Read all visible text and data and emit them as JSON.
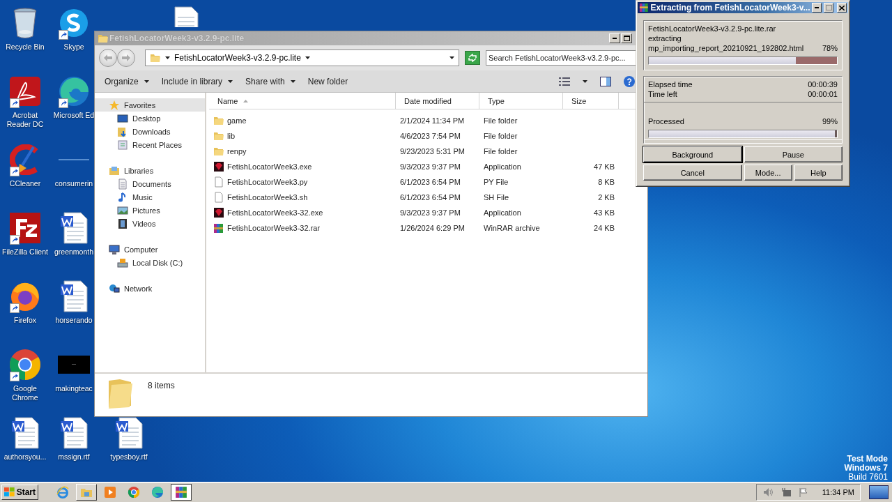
{
  "desktop": {
    "columns": [
      [
        {
          "label": "Recycle Bin",
          "kind": "recycle",
          "shortcut": false
        },
        {
          "label": "Acrobat Reader DC",
          "kind": "acrobat",
          "shortcut": true
        },
        {
          "label": "CCleaner",
          "kind": "ccleaner",
          "shortcut": true
        },
        {
          "label": "FileZilla Client",
          "kind": "filezilla",
          "shortcut": true
        },
        {
          "label": "Firefox",
          "kind": "firefox",
          "shortcut": true
        },
        {
          "label": "Google Chrome",
          "kind": "chrome",
          "shortcut": true
        },
        {
          "label": "authorsyou...",
          "kind": "word",
          "shortcut": false
        }
      ],
      [
        {
          "label": "Skype",
          "kind": "skype",
          "shortcut": true
        },
        {
          "label": "Microsoft Ed",
          "kind": "edge",
          "shortcut": true
        },
        {
          "label": "consumerin",
          "kind": "blank",
          "shortcut": false
        },
        {
          "label": "greenmonth",
          "kind": "word",
          "shortcut": false
        },
        {
          "label": "horserando",
          "kind": "word",
          "shortcut": false
        },
        {
          "label": "makingteac",
          "kind": "black",
          "shortcut": false
        },
        {
          "label": "mssign.rtf",
          "kind": "word",
          "shortcut": false
        }
      ],
      [
        null,
        null,
        null,
        null,
        null,
        null,
        {
          "label": "typesboy.rtf",
          "kind": "word",
          "shortcut": false
        }
      ],
      [
        {
          "kind": "document",
          "shortcut": false
        }
      ]
    ],
    "notice": [
      "Test Mode",
      "Windows 7",
      "Build 7601"
    ]
  },
  "explorer": {
    "title": "FetishLocatorWeek3-v3.2.9-pc.lite",
    "address": "FetishLocatorWeek3-v3.2.9-pc.lite",
    "search": {
      "placeholder": "Search FetishLocatorWeek3-v3.2.9-pc..."
    },
    "toolbar": [
      {
        "label": "Organize",
        "dropdown": true
      },
      {
        "label": "Include in library",
        "dropdown": true
      },
      {
        "label": "Share with",
        "dropdown": true
      },
      {
        "label": "New folder",
        "dropdown": false
      }
    ],
    "nav": [
      {
        "label": "Favorites",
        "kind": "star",
        "selected": true,
        "children": [
          {
            "label": "Desktop",
            "kind": "desktop",
            "selected": false
          },
          {
            "label": "Downloads",
            "kind": "downloads",
            "selected": false
          },
          {
            "label": "Recent Places",
            "kind": "recent",
            "selected": false
          }
        ]
      },
      {
        "label": "Libraries",
        "kind": "library",
        "selected": false,
        "children": [
          {
            "label": "Documents",
            "kind": "documents",
            "selected": false
          },
          {
            "label": "Music",
            "kind": "music",
            "selected": false
          },
          {
            "label": "Pictures",
            "kind": "pictures",
            "selected": false
          },
          {
            "label": "Videos",
            "kind": "videos",
            "selected": false
          }
        ]
      },
      {
        "label": "Computer",
        "kind": "computer",
        "selected": false,
        "children": [
          {
            "label": "Local Disk (C:)",
            "kind": "disk",
            "selected": false
          }
        ]
      },
      {
        "label": "Network",
        "kind": "network",
        "selected": false
      }
    ],
    "columns": [
      {
        "label": "Name",
        "sorted": true
      },
      {
        "label": "Date modified",
        "sorted": false
      },
      {
        "label": "Type",
        "sorted": false
      },
      {
        "label": "Size",
        "sorted": false
      }
    ],
    "files": [
      {
        "name": "game",
        "date": "2/1/2024 11:34 PM",
        "type": "File folder",
        "kind": "folder"
      },
      {
        "name": "lib",
        "date": "4/6/2023 7:54 PM",
        "type": "File folder",
        "kind": "folder"
      },
      {
        "name": "renpy",
        "date": "9/23/2023 5:31 PM",
        "type": "File folder",
        "kind": "folder"
      },
      {
        "name": "FetishLocatorWeek3.exe",
        "date": "9/3/2023 9:37 PM",
        "type": "Application",
        "size": "47 KB",
        "kind": "app"
      },
      {
        "name": "FetishLocatorWeek3.py",
        "date": "6/1/2023 6:54 PM",
        "type": "PY File",
        "size": "8 KB",
        "kind": "file"
      },
      {
        "name": "FetishLocatorWeek3.sh",
        "date": "6/1/2023 6:54 PM",
        "type": "SH File",
        "size": "2 KB",
        "kind": "file"
      },
      {
        "name": "FetishLocatorWeek3-32.exe",
        "date": "9/3/2023 9:37 PM",
        "type": "Application",
        "size": "43 KB",
        "kind": "app"
      },
      {
        "name": "FetishLocatorWeek3-32.rar",
        "date": "1/26/2024 6:29 PM",
        "type": "WinRAR archive",
        "size": "24 KB",
        "kind": "rar"
      }
    ],
    "details": "8 items"
  },
  "extract_dialog": {
    "title": "Extracting from FetishLocatorWeek3-v...",
    "archive": "FetishLocatorWeek3-v3.2.9-pc.lite.rar",
    "action": "extracting",
    "current_file": "mp_importing_report_20210921_192802.html",
    "file_percent": "78%",
    "file_progress": {
      "level": 0.78
    },
    "elapsed_label": "Elapsed time",
    "elapsed": "00:00:39",
    "left_label": "Time left",
    "left": "00:00:01",
    "processed_label": "Processed",
    "processed_percent": "99%",
    "total_progress": {
      "level": 0.99
    },
    "buttons": [
      {
        "label": "Background",
        "default": true
      },
      {
        "label": "Pause",
        "default": false
      },
      {
        "label": "Cancel",
        "default": false
      },
      {
        "label": "Mode...",
        "default": false
      },
      {
        "label": "Help",
        "default": false
      }
    ]
  },
  "taskbar": {
    "start": "Start",
    "apps": [
      {
        "kind": "ie",
        "open": false,
        "active": false
      },
      {
        "kind": "explorer",
        "open": true,
        "active": false
      },
      {
        "kind": "media",
        "open": false,
        "active": false
      },
      {
        "kind": "chrome",
        "open": false,
        "active": false
      },
      {
        "kind": "edge",
        "open": false,
        "active": false
      },
      {
        "kind": "winrar",
        "open": false,
        "active": true
      }
    ],
    "clock": "11:34 PM"
  }
}
